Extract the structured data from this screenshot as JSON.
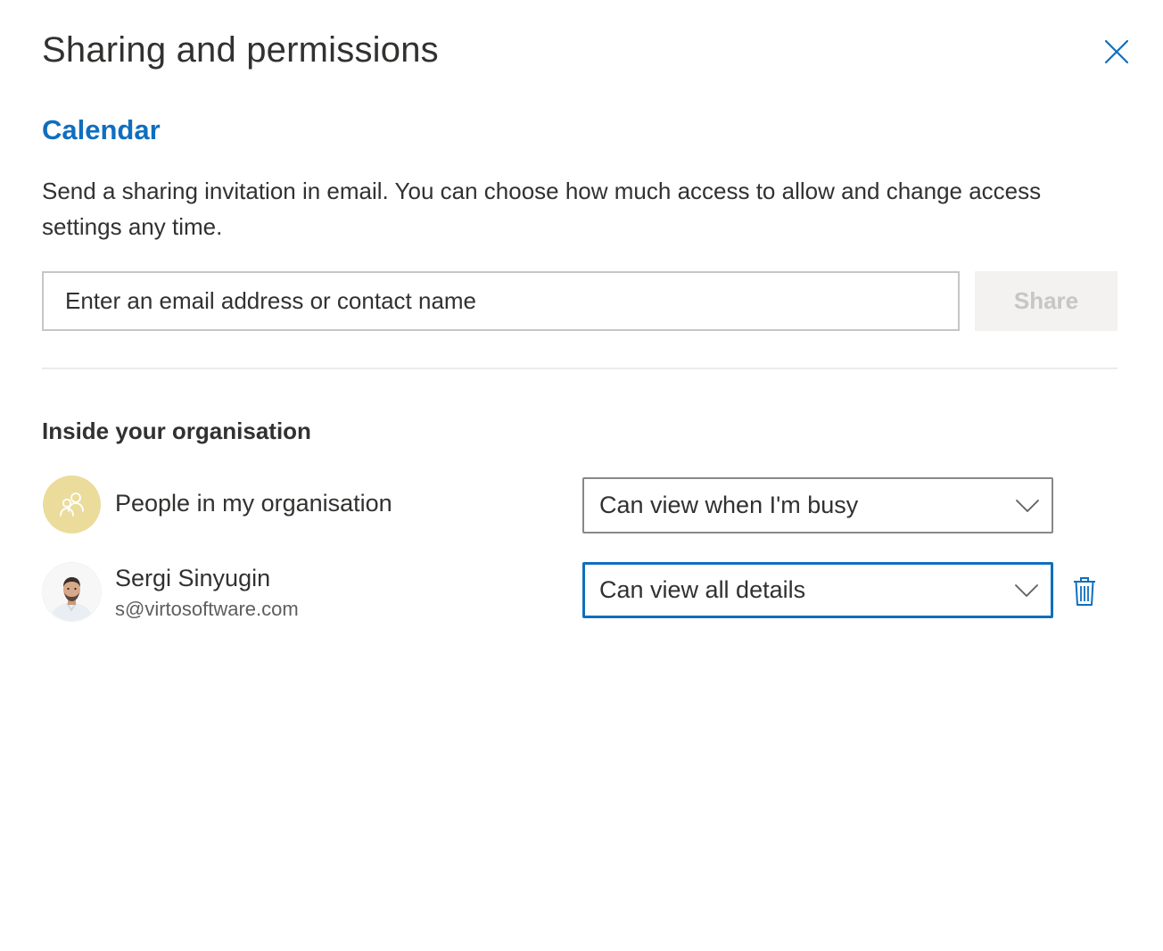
{
  "dialog": {
    "title": "Sharing and permissions",
    "close_icon": "close-icon"
  },
  "calendar": {
    "name": "Calendar",
    "description": "Send a sharing invitation in email. You can choose how much access to allow and change access settings any time."
  },
  "invite": {
    "placeholder": "Enter an email address or contact name",
    "value": "",
    "share_label": "Share",
    "share_disabled": true
  },
  "inside_org": {
    "heading": "Inside your organisation",
    "entries": [
      {
        "icon": "people-group-icon",
        "label": "People in my organisation",
        "permission": "Can view when I'm busy",
        "avatar_color": "#ebdc9c"
      },
      {
        "icon": "user-avatar",
        "name": "Sergi Sinyugin",
        "email": "s@virtosoftware.com",
        "permission": "Can view all details",
        "delete_icon": "trash-icon"
      }
    ]
  },
  "colors": {
    "accent": "#106ebe",
    "text": "#323130",
    "muted": "#605e5c",
    "border": "#8a8886",
    "disabled_bg": "#f3f2f1",
    "disabled_text": "#c8c6c4"
  }
}
